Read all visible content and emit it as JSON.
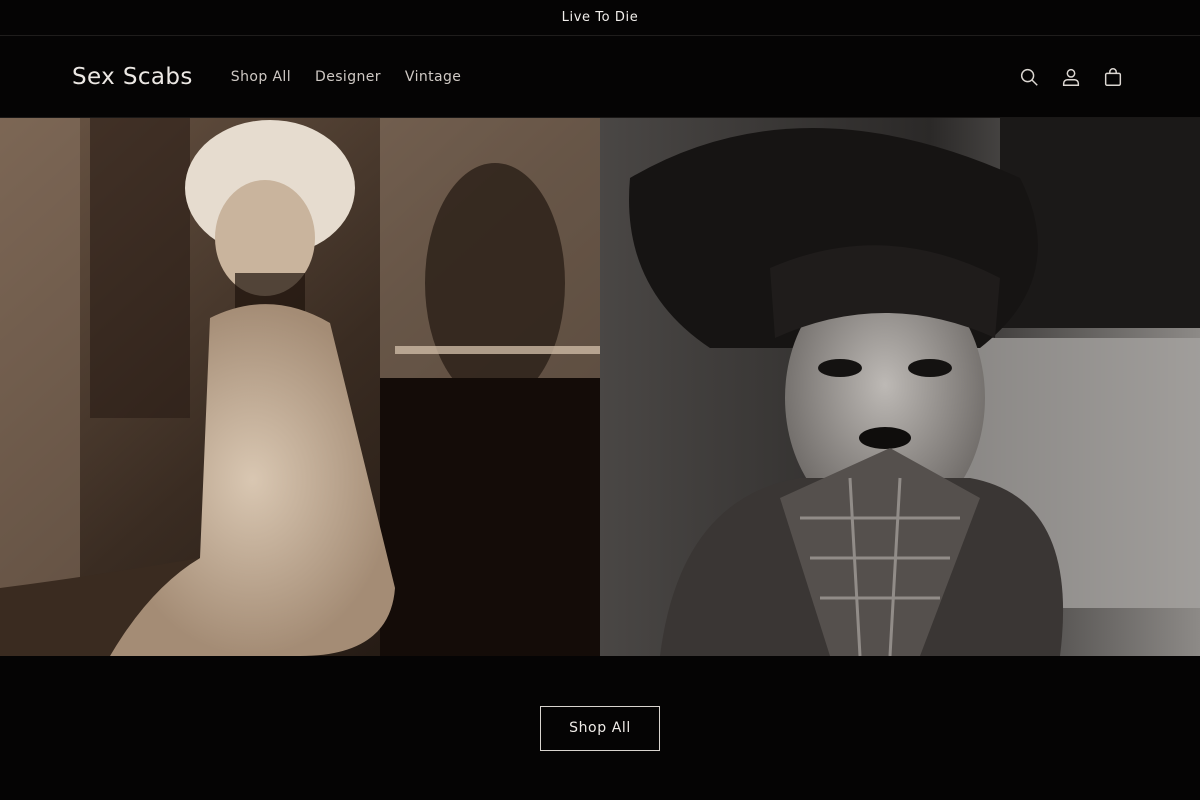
{
  "announcement": {
    "text": "Live To Die"
  },
  "header": {
    "logo": "Sex Scabs",
    "nav": [
      {
        "label": "Shop All"
      },
      {
        "label": "Designer"
      },
      {
        "label": "Vintage"
      }
    ],
    "icons": [
      "search-icon",
      "account-icon",
      "cart-icon"
    ]
  },
  "hero": {
    "images": [
      "sepia-photo-woman-in-white-dress-by-clothing-rack",
      "black-and-white-photo-woman-with-safety-pin-and-plaid-collar"
    ],
    "colors": {
      "sepia": "#5a4636",
      "mono": "#6e6b68"
    }
  },
  "cta": {
    "label": "Shop All"
  },
  "colors": {
    "background": "#050404",
    "text": "#e9e6e3",
    "border": "#d9d4cf"
  }
}
